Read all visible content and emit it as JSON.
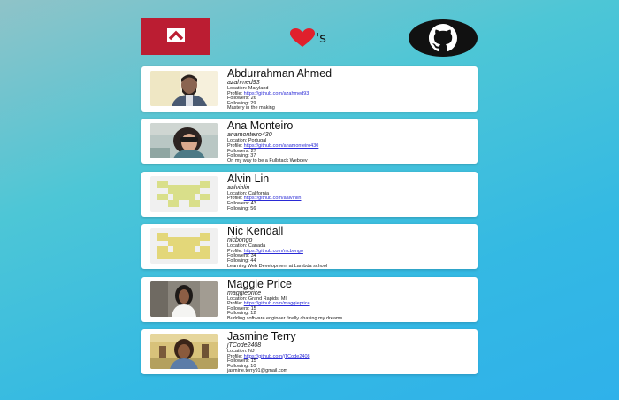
{
  "header": {
    "lambda_logo_icon": "lambda-logo-icon",
    "heart_icon": "heart-icon",
    "apostrophe_s": "'s",
    "github_logo_icon": "github-octocat-icon",
    "colors": {
      "lambda": "#bb1d32",
      "heart": "#e0202c",
      "github": "#111111"
    }
  },
  "labels": {
    "location": "Location:",
    "profile": "Profile:",
    "followers": "Followers:",
    "following": "Following:"
  },
  "users": [
    {
      "name": "Abdurrahman Ahmed",
      "login": "azahmed93",
      "location": "Maryland",
      "profile_url": "https://github.com/azahmed93",
      "followers": "26",
      "following": "29",
      "bio": "Mastery in the making",
      "avatar": "photo"
    },
    {
      "name": "Ana Monteiro",
      "login": "anamonteiro430",
      "location": "Portugal",
      "profile_url": "https://github.com/anamonteiro430",
      "followers": "27",
      "following": "37",
      "bio": "On my way to be a Fullstack Webdev",
      "avatar": "photo"
    },
    {
      "name": "Alvin Lin",
      "login": "aalvinlin",
      "location": "California",
      "profile_url": "https://github.com/aalvinlin",
      "followers": "43",
      "following": "56",
      "bio": "",
      "avatar": "identicon"
    },
    {
      "name": "Nic Kendall",
      "login": "nicbongo",
      "location": "Canada",
      "profile_url": "https://github.com/nicbongo",
      "followers": "34",
      "following": "44",
      "bio": "Learning Web Development at Lambda school",
      "avatar": "identicon"
    },
    {
      "name": "Maggie Price",
      "login": "maggieprice",
      "location": "Grand Rapids, MI",
      "profile_url": "https://github.com/maggieprice",
      "followers": "15",
      "following": "12",
      "bio": "Budding software engineer finally chasing my dreams...",
      "avatar": "photo"
    },
    {
      "name": "Jasmine Terry",
      "login": "jTCode2408",
      "location": "NJ",
      "profile_url": "https://github.com/jTCode2408",
      "followers": "15",
      "following": "10",
      "bio": "jasmine.terry91@gmail.com",
      "avatar": "photo"
    }
  ]
}
